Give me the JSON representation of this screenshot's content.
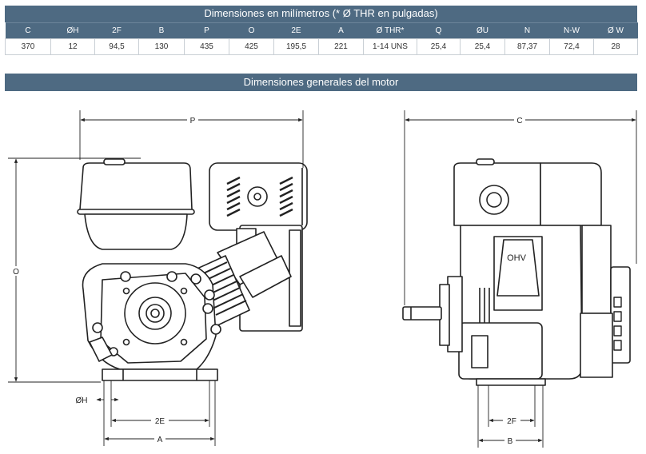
{
  "dimensions_table": {
    "title": "Dimensiones en milímetros (* Ø THR en pulgadas)",
    "headers": [
      "C",
      "ØH",
      "2F",
      "B",
      "P",
      "O",
      "2E",
      "A",
      "Ø THR*",
      "Q",
      "ØU",
      "N",
      "N-W",
      "Ø W"
    ],
    "values": [
      "370",
      "12",
      "94,5",
      "130",
      "435",
      "425",
      "195,5",
      "221",
      "1-14 UNS",
      "25,4",
      "25,4",
      "87,37",
      "72,4",
      "28"
    ]
  },
  "motor_section": {
    "title": "Dimensiones generales del motor"
  },
  "drawing_labels": {
    "front": {
      "P": "P",
      "O": "O",
      "H": "ØH",
      "E": "2E",
      "A": "A"
    },
    "side": {
      "C": "C",
      "F": "2F",
      "B": "B"
    }
  }
}
